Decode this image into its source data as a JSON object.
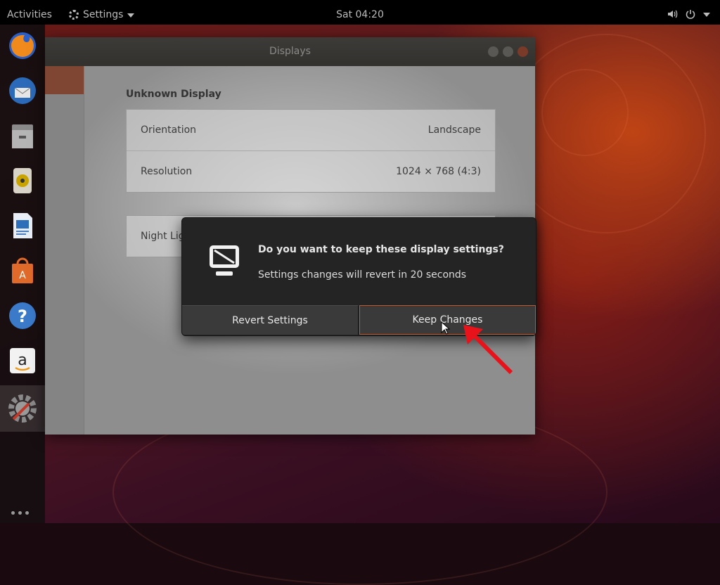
{
  "topbar": {
    "activities": "Activities",
    "app_name": "Settings",
    "clock": "Sat 04:20"
  },
  "dock": {
    "apps": [
      "firefox-icon",
      "thunderbird-icon",
      "files-icon",
      "rhythmbox-icon",
      "writer-icon",
      "software-icon",
      "help-icon",
      "amazon-icon",
      "settings-icon"
    ]
  },
  "window": {
    "title": "Displays",
    "section_title": "Unknown Display",
    "orientation_label": "Orientation",
    "orientation_value": "Landscape",
    "resolution_label": "Resolution",
    "resolution_value": "1024 × 768 (4:3)",
    "night_light_label": "Night Light"
  },
  "dialog": {
    "title": "Do you want to keep these display settings?",
    "subtitle": "Settings changes will revert in 20 seconds",
    "revert_label": "Revert Settings",
    "keep_label": "Keep Changes"
  },
  "colors": {
    "accent": "#c2552a",
    "annotation_arrow": "#e8131a"
  }
}
